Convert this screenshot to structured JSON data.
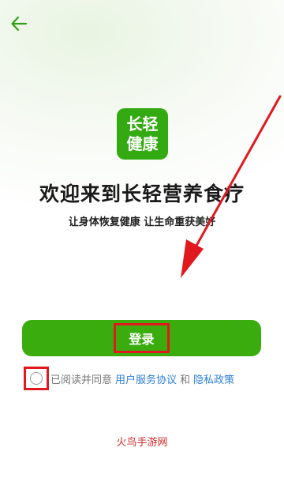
{
  "header": {
    "back_icon": "arrow-left-icon"
  },
  "logo": {
    "line1": "长轻",
    "line2": "健康",
    "color": "#33aa11"
  },
  "welcome": {
    "title": "欢迎来到长轻营养食疗",
    "subtitle": "让身体恢复健康 让生命重获美好"
  },
  "login": {
    "label": "登录",
    "color": "#3aac0e"
  },
  "agreement": {
    "prefix": "已阅读并同意",
    "user_agreement": "用户服务协议",
    "and": "和",
    "privacy_policy": "隐私政策",
    "link_color": "#2e7fd6"
  },
  "watermark": {
    "text": "火鸟手游网"
  },
  "annotation_color": "#e1191e"
}
